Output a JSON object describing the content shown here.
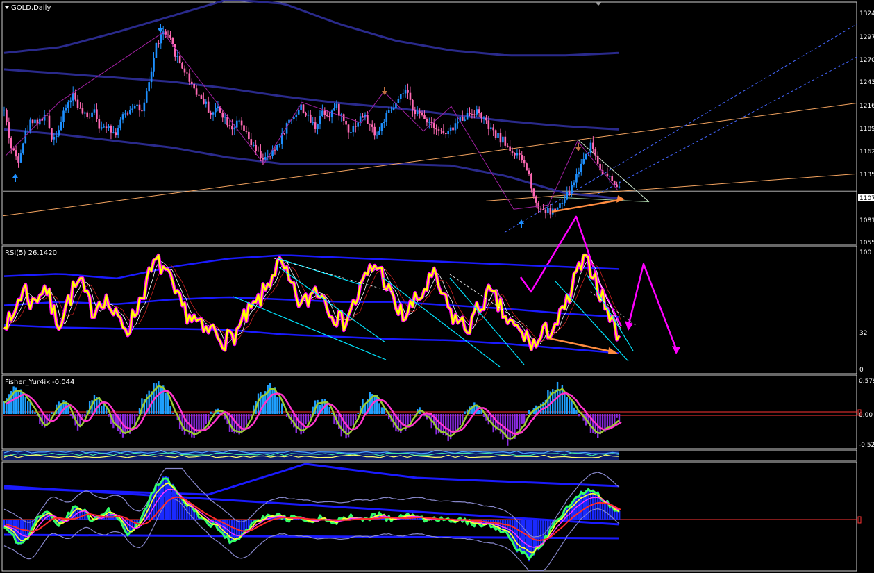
{
  "chart_data": [
    {
      "type": "candlestick",
      "title": "GOLD,Daily",
      "ylim": [
        1043,
        1336
      ],
      "y_ticks": [
        "1324",
        "1297",
        "1270",
        "1243",
        "1216",
        "1189",
        "1162",
        "1135",
        "1081",
        "1055"
      ],
      "current_price": "1107",
      "current_price_value": 1107,
      "closes": [
        1205,
        1160,
        1145,
        1175,
        1195,
        1190,
        1200,
        1170,
        1185,
        1210,
        1225,
        1205,
        1195,
        1210,
        1180,
        1190,
        1175,
        1195,
        1205,
        1215,
        1200,
        1240,
        1285,
        1300,
        1290,
        1270,
        1255,
        1240,
        1225,
        1215,
        1200,
        1210,
        1195,
        1185,
        1190,
        1175,
        1160,
        1150,
        1145,
        1155,
        1170,
        1190,
        1200,
        1210,
        1195,
        1185,
        1205,
        1200,
        1210,
        1195,
        1180,
        1190,
        1200,
        1185,
        1175,
        1195,
        1205,
        1215,
        1230,
        1210,
        1200,
        1195,
        1190,
        1180,
        1175,
        1185,
        1195,
        1200,
        1205,
        1200,
        1185,
        1175,
        1170,
        1160,
        1150,
        1145,
        1125,
        1090,
        1085,
        1082,
        1085,
        1095,
        1110,
        1130,
        1150,
        1165,
        1140,
        1125,
        1120,
        1108
      ],
      "line_colors": {
        "bull": "#1e90ff",
        "bear": "#ff69b4",
        "ma": "#2a2a8c",
        "trend_orange": "#f4a460",
        "dashed_blue": "#4466ff",
        "arrow_orange": "#ff8c40",
        "arrow_magenta": "#ff00ff",
        "marker_blue": "#1e90ff",
        "marker_brown": "#c07040"
      }
    },
    {
      "type": "line",
      "title": "RSI(5) 26.1420",
      "ylim": [
        0,
        100
      ],
      "y_ticks": [
        "100",
        "32",
        "0"
      ],
      "series_values": [
        45,
        38,
        60,
        70,
        55,
        65,
        72,
        50,
        40,
        55,
        68,
        75,
        60,
        50,
        62,
        58,
        45,
        40,
        35,
        50,
        65,
        80,
        92,
        88,
        75,
        60,
        52,
        45,
        40,
        30,
        35,
        30,
        25,
        28,
        35,
        45,
        52,
        60,
        70,
        85,
        90,
        78,
        65,
        55,
        60,
        70,
        65,
        55,
        45,
        40,
        50,
        60,
        75,
        85,
        90,
        78,
        62,
        50,
        45,
        55,
        60,
        70,
        80,
        70,
        55,
        45,
        40,
        35,
        45,
        55,
        65,
        60,
        50,
        40,
        35,
        30,
        25,
        20,
        30,
        35,
        40,
        50,
        65,
        85,
        92,
        88,
        70,
        55,
        40,
        30
      ],
      "line_colors": {
        "rsi": "#ffff00",
        "rsi_glow": "#ff00ff",
        "trend": "#00e5ff"
      }
    },
    {
      "type": "bar",
      "title": "Fisher_Yur4ik -0.044",
      "ylim": [
        -0.58,
        0.62
      ],
      "y_ticks": [
        "0.579",
        "0.00",
        "-0.52"
      ],
      "series_values": [
        0.2,
        0.35,
        0.45,
        0.3,
        0.1,
        -0.1,
        -0.2,
        0.05,
        0.2,
        0.15,
        -0.1,
        -0.25,
        0.1,
        0.3,
        0.2,
        0.0,
        -0.2,
        -0.35,
        -0.3,
        -0.1,
        0.2,
        0.4,
        0.5,
        0.45,
        0.2,
        -0.1,
        -0.3,
        -0.4,
        -0.35,
        -0.2,
        0.0,
        0.15,
        -0.1,
        -0.3,
        -0.4,
        -0.2,
        0.1,
        0.3,
        0.45,
        0.4,
        0.2,
        -0.05,
        -0.25,
        -0.3,
        -0.1,
        0.15,
        0.25,
        0.1,
        -0.15,
        -0.35,
        -0.3,
        -0.1,
        0.2,
        0.35,
        0.3,
        0.1,
        -0.15,
        -0.3,
        -0.25,
        -0.05,
        0.1,
        0.0,
        -0.2,
        -0.35,
        -0.4,
        -0.3,
        -0.15,
        0.05,
        0.15,
        0.05,
        -0.1,
        -0.25,
        -0.4,
        -0.45,
        -0.35,
        -0.2,
        0.0,
        0.15,
        0.25,
        0.35,
        0.45,
        0.4,
        0.25,
        0.05,
        -0.15,
        -0.3,
        -0.35,
        -0.25,
        -0.15,
        -0.05
      ],
      "line_colors": {
        "pos": "#1ea0ff",
        "neg": "#8a2be2",
        "line1": "#9acd32",
        "line2": "#ff33cc",
        "level": "#ff3333"
      }
    },
    {
      "type": "area",
      "title": "",
      "line_colors": {
        "bg": "#0a1a6a",
        "band1": "#4aa0ff",
        "band2": "#40e0a0",
        "band3": "#ffff66"
      }
    },
    {
      "type": "area",
      "title": "",
      "ylim": [
        -1,
        1
      ],
      "series_values": [
        -0.1,
        -0.3,
        -0.5,
        -0.45,
        -0.2,
        0.1,
        0.15,
        0.05,
        -0.1,
        0.05,
        0.2,
        0.25,
        0.1,
        -0.05,
        0.1,
        0.2,
        0.1,
        -0.1,
        -0.3,
        -0.2,
        0.1,
        0.4,
        0.7,
        0.85,
        0.75,
        0.55,
        0.4,
        0.25,
        0.1,
        0.0,
        -0.1,
        -0.2,
        -0.35,
        -0.45,
        -0.4,
        -0.25,
        -0.1,
        0.0,
        0.05,
        0.1,
        0.05,
        0.0,
        0.05,
        0.0,
        -0.05,
        0.0,
        0.05,
        0.0,
        -0.05,
        0.0,
        0.05,
        0.0,
        0.02,
        0.05,
        0.1,
        0.05,
        0.0,
        0.02,
        0.05,
        0.08,
        0.05,
        0.0,
        -0.02,
        0.0,
        0.02,
        0.0,
        -0.02,
        -0.05,
        -0.08,
        -0.1,
        -0.12,
        -0.15,
        -0.2,
        -0.35,
        -0.55,
        -0.7,
        -0.75,
        -0.6,
        -0.45,
        -0.25,
        0.0,
        0.15,
        0.3,
        0.45,
        0.55,
        0.6,
        0.5,
        0.35,
        0.25,
        0.15
      ],
      "line_colors": {
        "hist": "#1a2aff",
        "green": "#33ff66",
        "yellow": "#ffff33",
        "red": "#ff2a2a",
        "magenta": "#ff33ff",
        "ma_blue": "#1a1aff",
        "band": "#8888cc",
        "level": "#ff3333"
      }
    }
  ]
}
